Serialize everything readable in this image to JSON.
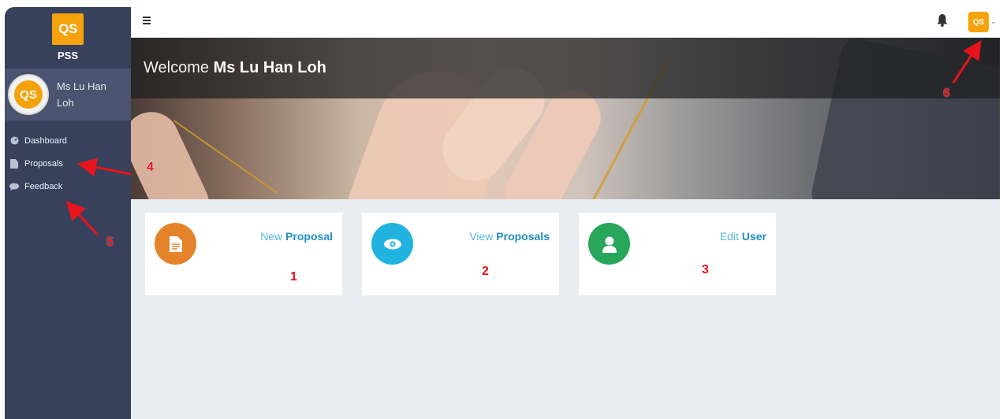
{
  "brand": {
    "logo_text": "QS",
    "name": "PSS",
    "accent": "#f5a20c"
  },
  "user": {
    "avatar_text": "QS",
    "name": "Ms Lu Han Loh"
  },
  "sidebar": {
    "items": [
      {
        "label": "Dashboard",
        "icon": "dashboard-icon"
      },
      {
        "label": "Proposals",
        "icon": "document-icon"
      },
      {
        "label": "Feedback",
        "icon": "comment-icon"
      }
    ]
  },
  "topbar": {
    "menu_icon": "hamburger-icon",
    "notification_icon": "bell-icon",
    "avatar_text": "QS",
    "dropdown_icon": "chevron-down-icon"
  },
  "hero": {
    "welcome_prefix": "Welcome",
    "welcome_name": "Ms Lu Han Loh"
  },
  "cards": [
    {
      "title_light": "New",
      "title_bold": "Proposal",
      "icon": "file-icon",
      "color": "#e4832a"
    },
    {
      "title_light": "View",
      "title_bold": "Proposals",
      "icon": "eye-icon",
      "color": "#21b3e0"
    },
    {
      "title_light": "Edit",
      "title_bold": "User",
      "icon": "user-icon",
      "color": "#28a65a"
    }
  ],
  "annotations": {
    "n1": "1",
    "n2": "2",
    "n3": "3",
    "n4": "4",
    "n5": "5",
    "n6": "6",
    "color": "#e8131b"
  }
}
